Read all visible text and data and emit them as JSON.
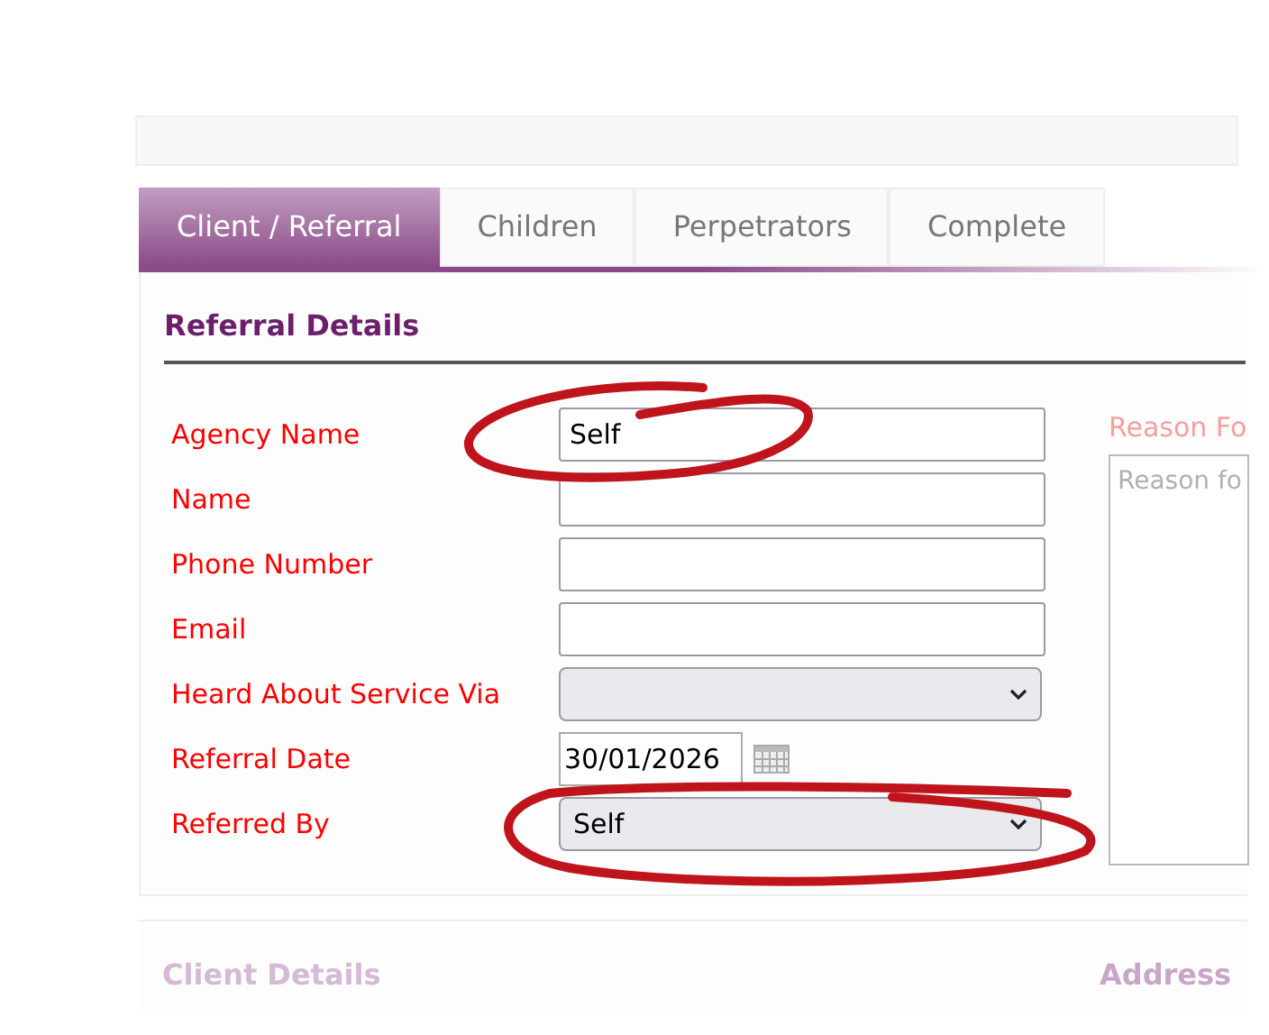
{
  "tabs": [
    {
      "label": "Client / Referral",
      "selected": true
    },
    {
      "label": "Children",
      "selected": false
    },
    {
      "label": "Perpetrators",
      "selected": false
    },
    {
      "label": "Complete",
      "selected": false
    }
  ],
  "referral_details": {
    "title": "Referral Details",
    "fields": [
      {
        "kind": "text",
        "label": "Agency Name",
        "value": "Self"
      },
      {
        "kind": "text",
        "label": "Name"
      },
      {
        "kind": "text",
        "label": "Phone Number"
      },
      {
        "kind": "text",
        "label": "Email"
      },
      {
        "kind": "select",
        "label": "Heard About Service Via"
      },
      {
        "kind": "date",
        "label": "Referral Date",
        "value": "30/01/2026"
      },
      {
        "kind": "select",
        "label": "Referred By",
        "value": "Self"
      }
    ],
    "reason": {
      "label": "Reason Fo",
      "placeholder": "Reason fo"
    }
  },
  "client_details": {
    "title": "Client Details",
    "address_title": "Address"
  }
}
